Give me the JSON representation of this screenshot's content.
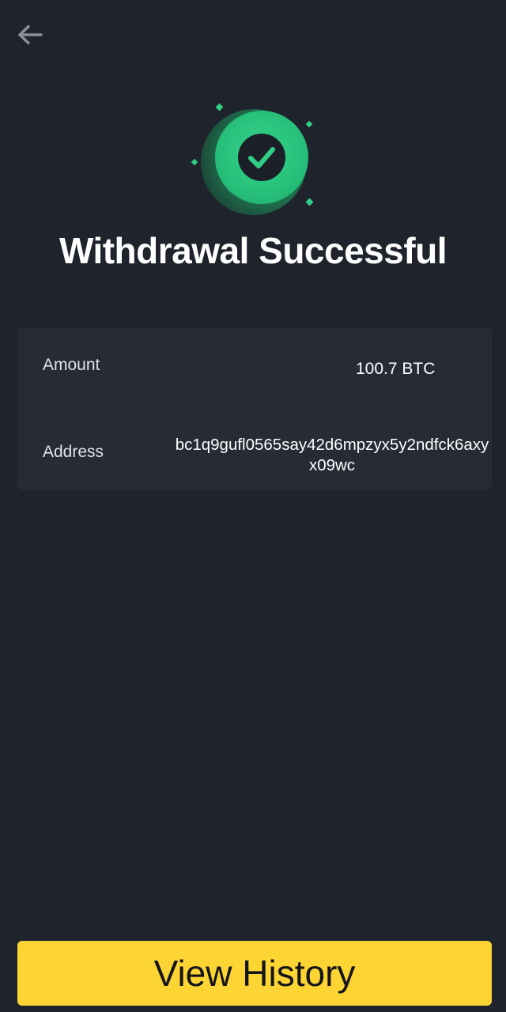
{
  "header": {
    "back_icon": "arrow-left-icon"
  },
  "status": {
    "icon": "check-circle-icon",
    "title": "Withdrawal Successful"
  },
  "details": {
    "amount_label": "Amount",
    "amount_value": "100.7 BTC",
    "address_label": "Address",
    "address_value": "bc1q9gufl0565say42d6mpzyx5y2ndfck6axyx09wc"
  },
  "actions": {
    "view_history_label": "View History"
  },
  "colors": {
    "background": "#1f232c",
    "card": "#272b35",
    "success": "#27c07a",
    "primary_button": "#fcd535"
  }
}
